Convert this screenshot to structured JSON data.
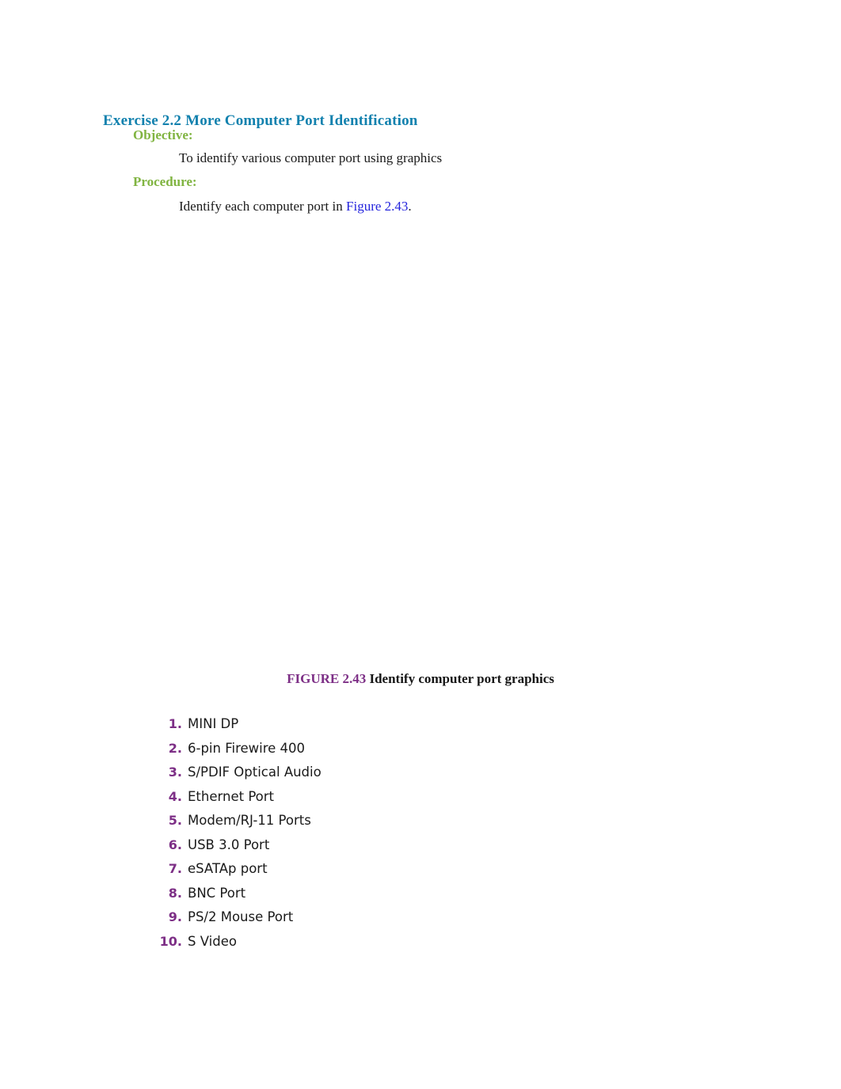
{
  "document": {
    "heading": "Exercise 2.2 More  Computer Port Identification",
    "objective": {
      "label": "Objective:",
      "text": "To identify various computer port using graphics"
    },
    "procedure": {
      "label": "Procedure:",
      "text_before_link": "Identify each computer port in ",
      "link_text": "Figure 2.43",
      "text_after_link": "."
    },
    "figure": {
      "label": "FIGURE 2.43",
      "title": "Identify computer port graphics"
    },
    "answers": [
      {
        "num": "1.",
        "text": "MINI DP"
      },
      {
        "num": "2.",
        "text": "6-pin Firewire 400"
      },
      {
        "num": "3.",
        "text": "S/PDIF Optical Audio"
      },
      {
        "num": "4.",
        "text": "Ethernet Port"
      },
      {
        "num": "5.",
        "text": "Modem/RJ-11 Ports"
      },
      {
        "num": "6.",
        "text": "USB 3.0 Port"
      },
      {
        "num": "7.",
        "text": "eSATAp port"
      },
      {
        "num": "8.",
        "text": "BNC Port"
      },
      {
        "num": "9.",
        "text": "PS/2 Mouse Port"
      },
      {
        "num": "10.",
        "text": "S Video"
      }
    ],
    "colors": {
      "heading": "#1281ae",
      "section_label": "#80b441",
      "link": "#2424dd",
      "figure_label": "#7d2f86",
      "list_number": "#7d2f86",
      "body": "#1a1a1a",
      "background": "#ffffff"
    }
  }
}
